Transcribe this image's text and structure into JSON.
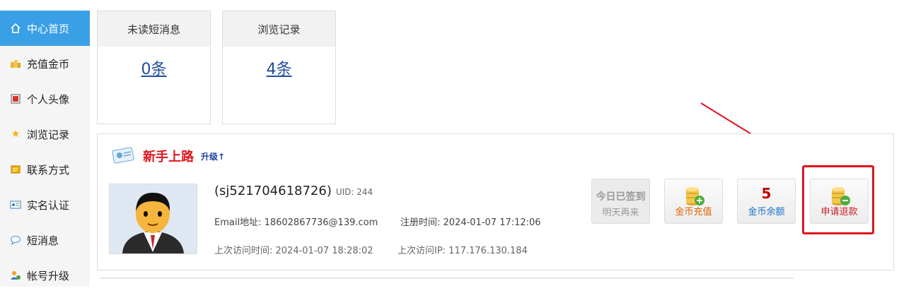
{
  "sidebar": {
    "items": [
      {
        "label": "中心首页",
        "icon": "home-icon"
      },
      {
        "label": "充值金币",
        "icon": "coins-icon"
      },
      {
        "label": "个人头像",
        "icon": "avatar-frame-icon"
      },
      {
        "label": "浏览记录",
        "icon": "star-icon"
      },
      {
        "label": "联系方式",
        "icon": "contact-card-icon"
      },
      {
        "label": "实名认证",
        "icon": "id-card-icon"
      },
      {
        "label": "短消息",
        "icon": "chat-bubble-icon"
      },
      {
        "label": "帐号升级",
        "icon": "user-upgrade-icon"
      }
    ]
  },
  "stats": {
    "unread": {
      "title": "未读短消息",
      "value": "0条"
    },
    "history": {
      "title": "浏览记录",
      "value": "4条"
    }
  },
  "panel": {
    "title": "新手上路",
    "upgrade": "升级↑",
    "username": "(sj521704618726)",
    "uid": "UID: 244",
    "email": "Email地址: 18602867736@139.com",
    "register": "注册时间: 2024-01-07 17:12:06",
    "last_visit": "上次访问时间: 2024-01-07 18:28:02",
    "last_ip": "上次访问IP: 117.176.130.184"
  },
  "actions": {
    "signed": {
      "line1": "今日已签到",
      "line2": "明天再来"
    },
    "recharge": {
      "label": "金币充值"
    },
    "balance": {
      "value": "5",
      "label": "金币余额"
    },
    "refund": {
      "label": "申请退款"
    }
  },
  "colors": {
    "accent": "#3aa0e6",
    "title_red": "#e0141e",
    "link_blue": "#1f4e9a",
    "recharge_orange": "#e06000",
    "balance_blue": "#1a73c8"
  }
}
